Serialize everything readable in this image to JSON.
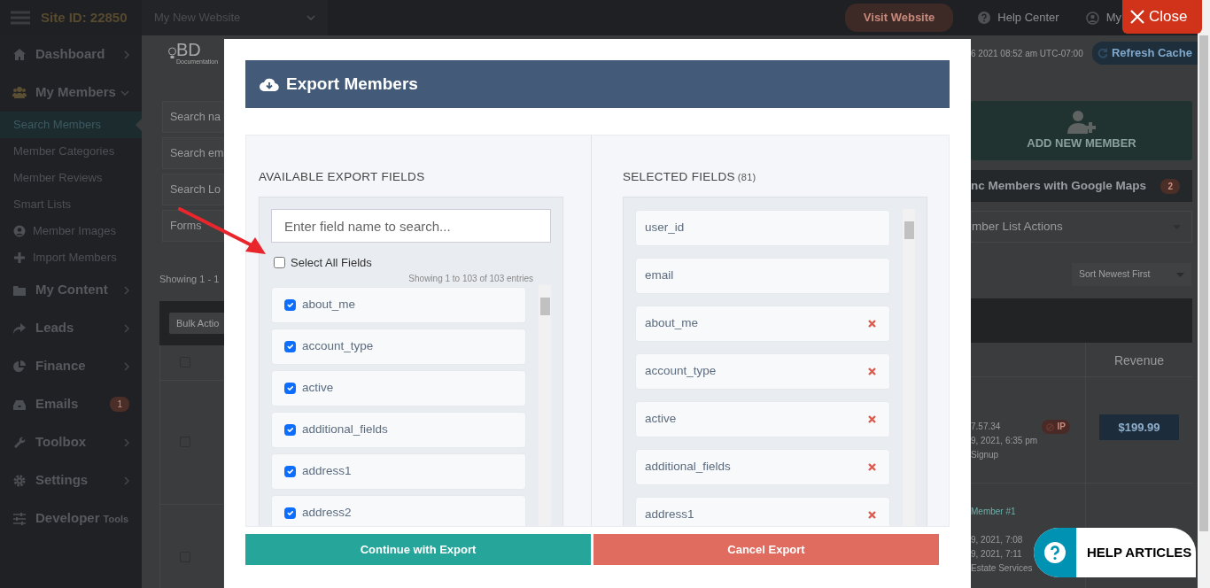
{
  "topbar": {
    "site_id": "Site ID: 22850",
    "website_select": "My New Website",
    "visit_button": "Visit Website",
    "help_link": "Help Center",
    "account_link": "My"
  },
  "header_info": {
    "datetime": "6 2021 08:52 am UTC-07:00",
    "refresh_button": "Refresh Cache"
  },
  "logo": {
    "text": "BD",
    "subtitle": "Documentation"
  },
  "sidebar": {
    "items": [
      {
        "label": "Dashboard",
        "expanded": false
      },
      {
        "label": "My Members",
        "expanded": true,
        "children": [
          {
            "label": "Search Members",
            "selected": true
          },
          {
            "label": "Member Categories",
            "selected": false
          },
          {
            "label": "Member Reviews",
            "selected": false
          },
          {
            "label": "Smart Lists",
            "selected": false
          },
          {
            "label": "Member Images",
            "selected": false
          },
          {
            "label": "Import Members",
            "selected": false
          }
        ]
      },
      {
        "label": "My Content",
        "expanded": false
      },
      {
        "label": "Leads",
        "expanded": false
      },
      {
        "label": "Finance",
        "expanded": false
      },
      {
        "label": "Emails",
        "badge": "1"
      },
      {
        "label": "Toolbox",
        "expanded": false
      },
      {
        "label": "Settings",
        "expanded": false
      },
      {
        "label": "Developer",
        "suffix": "Tools"
      }
    ]
  },
  "background_left": {
    "search_fields": [
      "Search na",
      "Search em",
      "Search Lo",
      "Forms"
    ],
    "showing": "Showing 1 - 1",
    "bulk_button": "Bulk Actio",
    "checkboxes": [
      {
        "checked": false
      },
      {
        "checked": false
      },
      {
        "checked": false
      }
    ]
  },
  "background_right": {
    "add_member": "ADD NEW MEMBER",
    "sync_button": "nc Members with Google Maps",
    "sync_badge": "2",
    "list_actions": "mber List Actions",
    "sort_select": "Sort Newest First",
    "revenue_header": "Revenue",
    "rows": [
      {
        "lines": [
          "7.57.34",
          "9, 2021, 6:35 pm",
          "Signup"
        ],
        "ip_badge": "IP",
        "amount": "$199.99"
      },
      {
        "link": "Member #1",
        "lines": [
          "9, 2021, 7:08",
          "9, 2021, 7:11",
          "Estate Services"
        ]
      }
    ]
  },
  "modal": {
    "title": "Export Members",
    "available": {
      "title": "AVAILABLE EXPORT FIELDS",
      "search_placeholder": "Enter field name to search...",
      "select_all": {
        "label": "Select All Fields",
        "checked": false
      },
      "entries_info": "Showing 1 to 103 of 103 entries",
      "fields": [
        {
          "name": "about_me",
          "checked": true
        },
        {
          "name": "account_type",
          "checked": true
        },
        {
          "name": "active",
          "checked": true
        },
        {
          "name": "additional_fields",
          "checked": true
        },
        {
          "name": "address1",
          "checked": true
        },
        {
          "name": "address2",
          "checked": true
        }
      ]
    },
    "selected": {
      "title": "SELECTED FIELDS",
      "count": "(81)",
      "fields": [
        {
          "name": "user_id",
          "removable": false
        },
        {
          "name": "email",
          "removable": false
        },
        {
          "name": "about_me",
          "removable": true
        },
        {
          "name": "account_type",
          "removable": true
        },
        {
          "name": "active",
          "removable": true
        },
        {
          "name": "additional_fields",
          "removable": true
        },
        {
          "name": "address1",
          "removable": true
        }
      ]
    },
    "buttons": [
      {
        "label": "Continue with Export",
        "kind": "primary"
      },
      {
        "label": "Cancel Export",
        "kind": "cancel"
      }
    ]
  },
  "close_button": "Close",
  "help_widget": "HELP ARTICLES"
}
